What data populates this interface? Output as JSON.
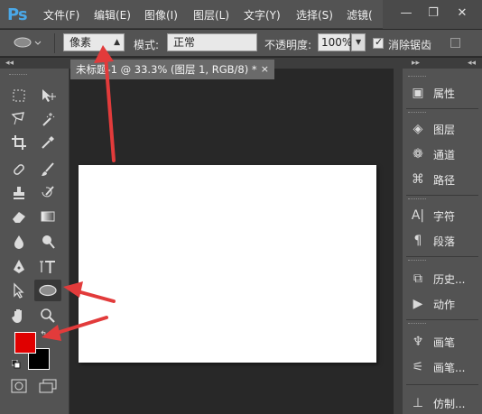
{
  "app": {
    "logo": "Ps"
  },
  "menu": [
    "文件(F)",
    "编辑(E)",
    "图像(I)",
    "图层(L)",
    "文字(Y)",
    "选择(S)",
    "滤镜("
  ],
  "window_controls": {
    "minimize_icon": "minimize-icon",
    "restore_icon": "restore-icon",
    "close_icon": "close-icon"
  },
  "options_bar": {
    "unit_select": "像素",
    "mode_label": "模式:",
    "mode_select": "正常",
    "opacity_label": "不透明度:",
    "opacity_value": "100%",
    "antialias_label": "消除锯齿",
    "antialias_checked": true
  },
  "document": {
    "tab_title": "未标题-1 @ 33.3% (图层 1, RGB/8) *",
    "tab_close": "×"
  },
  "colors": {
    "foreground": "#e00000",
    "background": "#000000",
    "annotation_arrow": "#e23b3b"
  },
  "panels": [
    {
      "icon": "properties-icon",
      "label": "属性"
    },
    {
      "icon": "layers-icon",
      "label": "图层"
    },
    {
      "icon": "channels-icon",
      "label": "通道"
    },
    {
      "icon": "paths-icon",
      "label": "路径"
    },
    {
      "icon": "character-icon",
      "label": "字符"
    },
    {
      "icon": "paragraph-icon",
      "label": "段落"
    },
    {
      "icon": "history-icon",
      "label": "历史..."
    },
    {
      "icon": "actions-icon",
      "label": "动作"
    },
    {
      "icon": "brush-icon",
      "label": "画笔"
    },
    {
      "icon": "brush-presets-icon",
      "label": "画笔..."
    },
    {
      "icon": "clone-source-icon",
      "label": "仿制..."
    }
  ],
  "toolbar": {
    "tools": [
      "marquee-tool",
      "move-tool",
      "lasso-tool",
      "magic-wand-tool",
      "crop-tool",
      "eyedropper-tool",
      "healing-brush-tool",
      "brush-tool",
      "clone-stamp-tool",
      "history-brush-tool",
      "eraser-tool",
      "gradient-tool",
      "blur-tool",
      "dodge-tool",
      "pen-tool",
      "type-tool",
      "path-selection-tool",
      "ellipse-tool",
      "hand-tool",
      "zoom-tool"
    ]
  }
}
